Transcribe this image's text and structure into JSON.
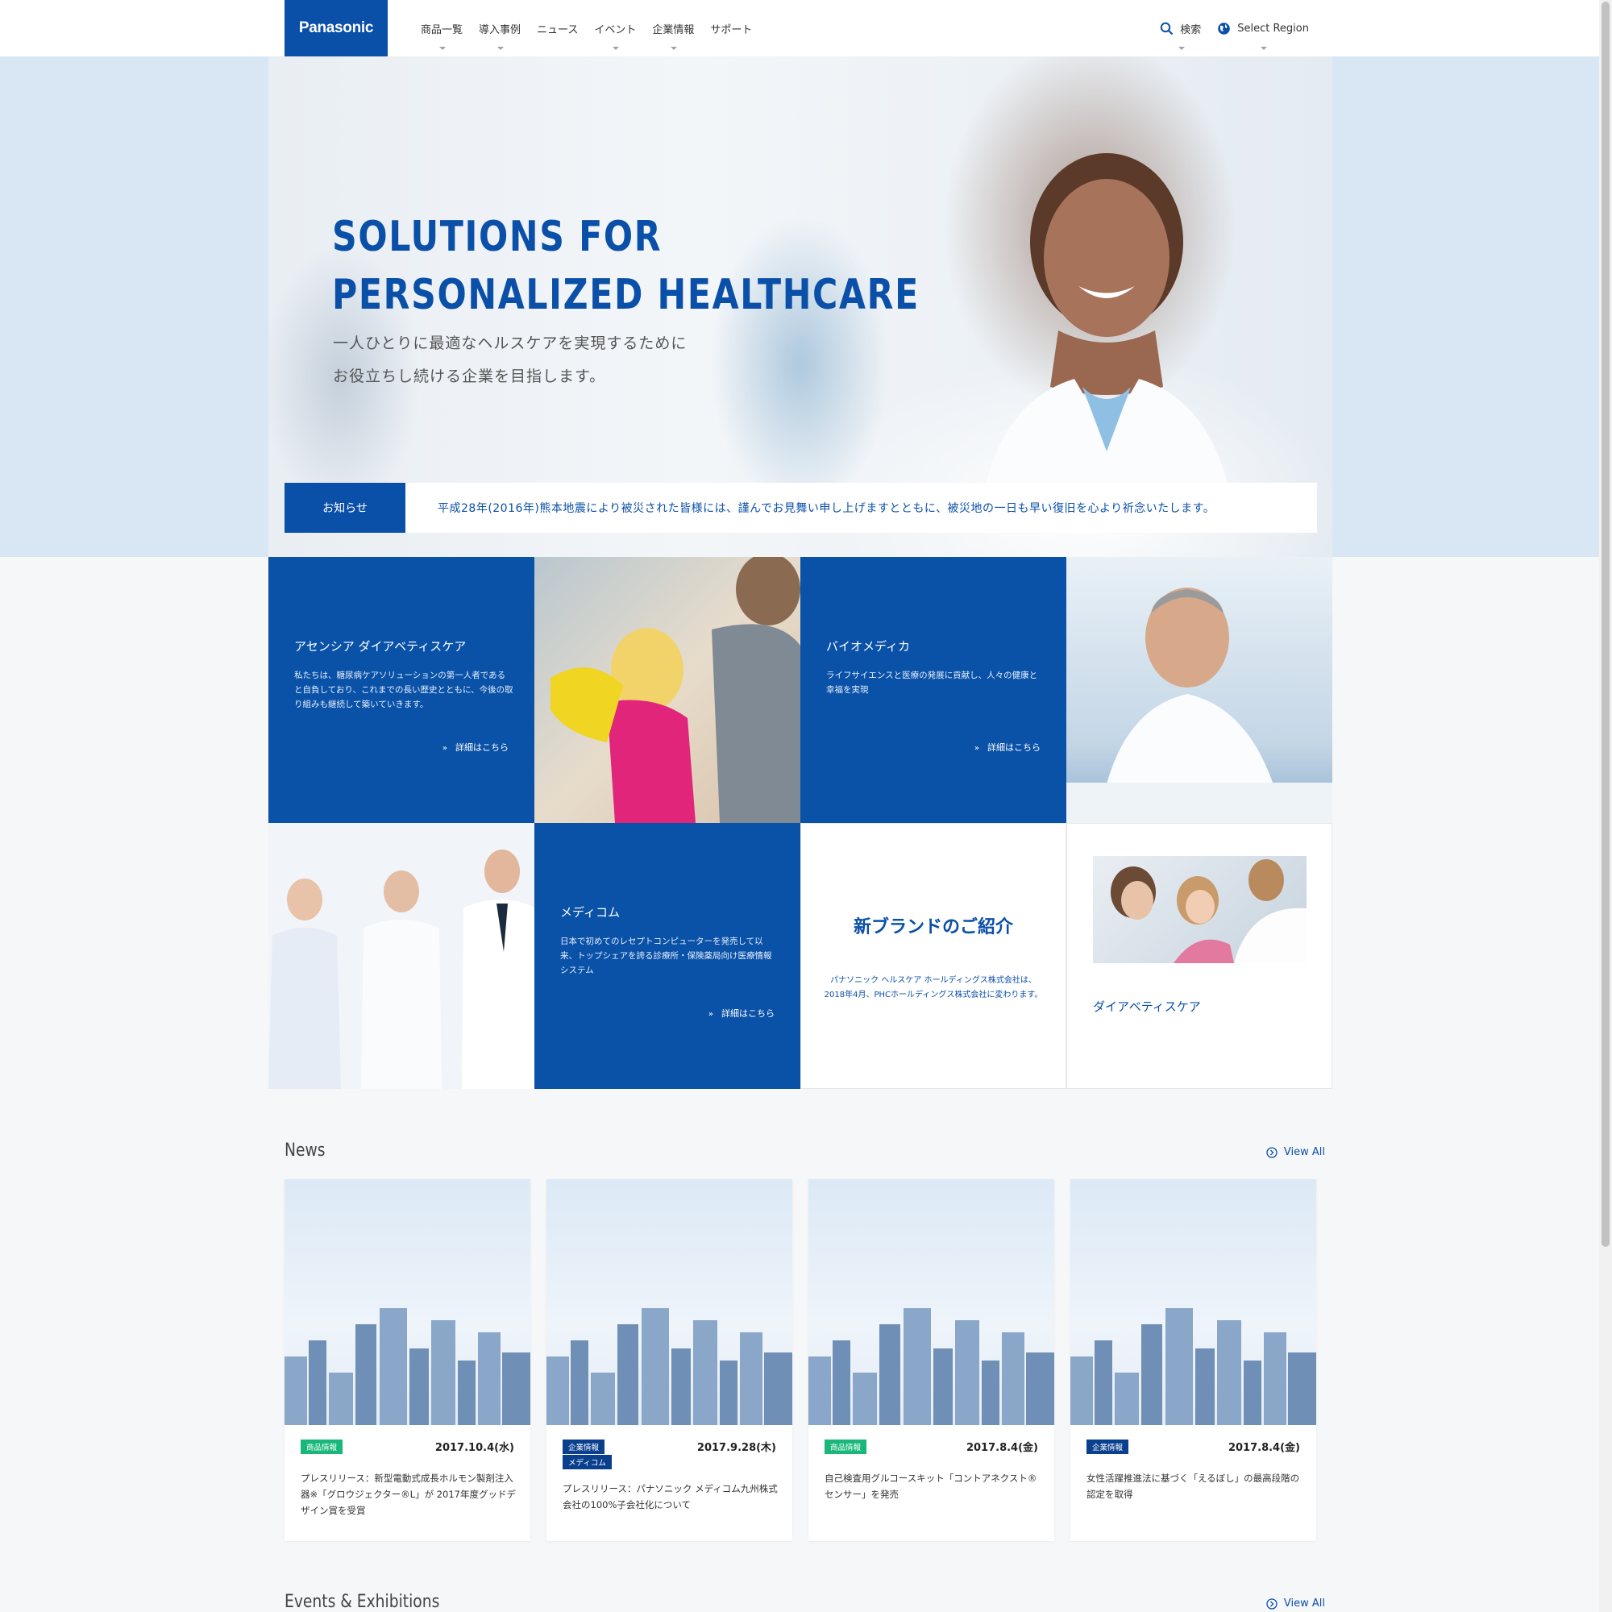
{
  "header": {
    "logo": "Panasonic",
    "nav": [
      "商品一覧",
      "導入事例",
      "ニュース",
      "イベント",
      "企業情報",
      "サポート"
    ],
    "search_label": "検索",
    "region_label": "Select Region"
  },
  "hero": {
    "title_line1": "SOLUTIONS FOR",
    "title_line2": "PERSONALIZED HEALTHCARE",
    "subtitle_line1": "一人ひとりに最適なヘルスケアを実現するために",
    "subtitle_line2": "お役立ちし続ける企業を目指します。",
    "notice_label": "お知らせ",
    "notice_text": "平成28年(2016年)熊本地震により被災された皆様には、謹んでお見舞い申し上げますとともに、被災地の一日も早い復旧を心より祈念いたします。"
  },
  "tiles": {
    "ascensia": {
      "title": "アセンシア ダイアベティスケア",
      "body": "私たちは、糖尿病ケアソリューションの第一人者であると自負しており、これまでの長い歴史とともに、今後の取り組みも継続して築いていきます。",
      "link": "詳細はこちら"
    },
    "biomedica": {
      "title": "バイオメディカ",
      "body": "ライフサイエンスと医療の発展に貢献し、人々の健康と幸福を実現",
      "link": "詳細はこちら"
    },
    "medicom": {
      "title": "メディコム",
      "body": "日本で初めてのレセプトコンピューターを発売して以来、トップシェアを誇る診療所・保険薬局向け医療情報システム",
      "link": "詳細はこちら"
    },
    "brand": {
      "title": "新ブランドのご紹介",
      "text_line1": "パナソニック ヘルスケア ホールディングス株式会社は、",
      "text_line2": "2018年4月、PHCホールディングス株式会社に変わります。"
    },
    "diabetes": {
      "label": "ダイアベティスケア"
    }
  },
  "news": {
    "title": "News",
    "view_all": "View All",
    "items": [
      {
        "tags": [
          "商品情報"
        ],
        "tag_colors": [
          "#19b87a"
        ],
        "date": "2017.10.4(水)",
        "text": "プレスリリース：新型電動式成長ホルモン製剤注入器※「グロウジェクター®L」が 2017年度グッドデザイン賞を受賞"
      },
      {
        "tags": [
          "企業情報",
          "メディコム"
        ],
        "tag_colors": [
          "#0a3f8e",
          "#0a3f8e"
        ],
        "date": "2017.9.28(木)",
        "text": "プレスリリース：パナソニック メディコム九州株式会社の100%子会社化について"
      },
      {
        "tags": [
          "商品情報"
        ],
        "tag_colors": [
          "#19b87a"
        ],
        "date": "2017.8.4(金)",
        "text": "自己検査用グルコースキット「コントアネクスト® センサー」を発売"
      },
      {
        "tags": [
          "企業情報"
        ],
        "tag_colors": [
          "#0a3f8e"
        ],
        "date": "2017.8.4(金)",
        "text": "女性活躍推進法に基づく「えるぼし」の最高段階の認定を取得"
      }
    ]
  },
  "events": {
    "title": "Events & Exhibitions",
    "view_all": "View All"
  },
  "colors": {
    "brand_blue": "#0a4fa8",
    "tile_blue": "#0a52a8",
    "tag_green": "#19b87a",
    "tag_navy": "#0a3f8e"
  }
}
